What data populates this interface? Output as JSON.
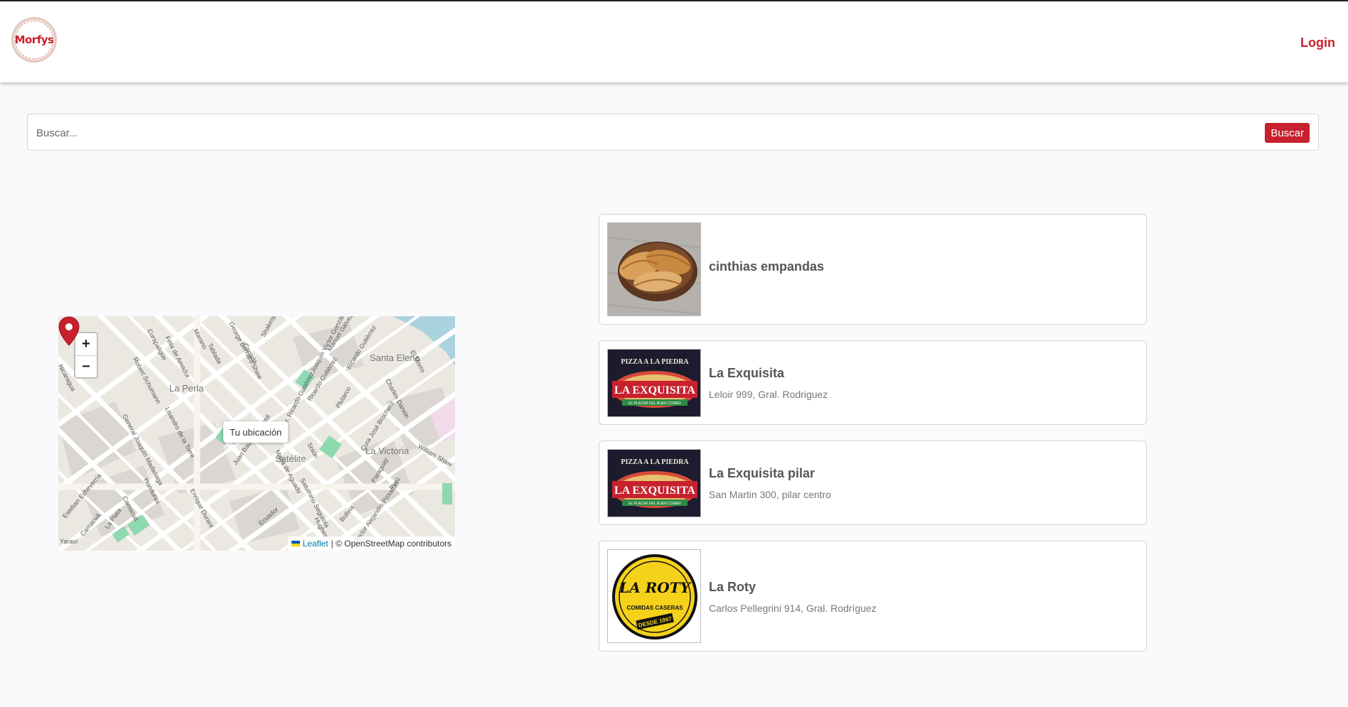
{
  "header": {
    "logo_text": "Morfys",
    "login_label": "Login"
  },
  "search": {
    "placeholder": "Buscar...",
    "button_label": "Buscar"
  },
  "map": {
    "zoom_in": "+",
    "zoom_out": "−",
    "popup_text": "Tu ubicación",
    "attribution_leaflet": "Leaflet",
    "attribution_rest": "| © OpenStreetMap contributors",
    "place_labels": [
      "La Perla",
      "Santa Elena",
      "Satélite",
      "La Victoria"
    ],
    "street_labels": [
      "Shakespeare",
      "Joaquín Víctor González",
      "Manuel Gálvez",
      "Ricardo Gutiérrez",
      "Charles Darwin",
      "Lisandro de la Torre",
      "General Joaquín Madariaga",
      "Enrique Durant",
      "Ecuador",
      "Bolivia",
      "Paraguay",
      "Honduras",
      "Nicaragua",
      "William Shaw",
      "Curapaligüe",
      "Marano",
      "Tablada",
      "Canadá",
      "George Bernard Shaw",
      "El Morro",
      "Solón",
      "Hughes",
      "Plutarco",
      "Cura José Brochero",
      "Dr. Ricardo Gutiérrez",
      "Saturnino Segurola",
      "Félix de Amador",
      "Robert Schumann",
      "Esteban Echeverría",
      "Camacuá",
      "La Plata",
      "Yaraví",
      "Doctor Alejandro Posadas",
      "Perú",
      "Juan Bautista Alberdi",
      "Ricardo Gutiérrez",
      "Maria de Aguado",
      "Camacuá"
    ]
  },
  "restaurants": [
    {
      "name": "cinthias empandas",
      "address": "",
      "image": "empanadas-photo"
    },
    {
      "name": "La Exquisita",
      "address": "Leloir 999, Gral. Rodriguez",
      "image": "la-exquisita-logo",
      "logo_top": "PIZZA A LA PIEDRA",
      "logo_main": "LA EXQUISITA",
      "logo_sub": "EL PLACER DEL BUEN COMER"
    },
    {
      "name": "La Exquisita pilar",
      "address": "San Martin 300, pilar centro",
      "image": "la-exquisita-logo",
      "logo_top": "PIZZA A LA PIEDRA",
      "logo_main": "LA EXQUISITA",
      "logo_sub": "EL PLACER DEL BUEN COMER"
    },
    {
      "name": "La Roty",
      "address": "Carlos Pellegrini 914, Gral. Rodríguez",
      "image": "la-roty-logo",
      "logo_main": "LA ROTY",
      "logo_sub": "COMIDAS CASERAS",
      "logo_since": "DESDE 1997"
    }
  ],
  "colors": {
    "brand_red": "#c8202d",
    "page_bg": "#faf9fb",
    "park_green": "#8fd9b0"
  }
}
